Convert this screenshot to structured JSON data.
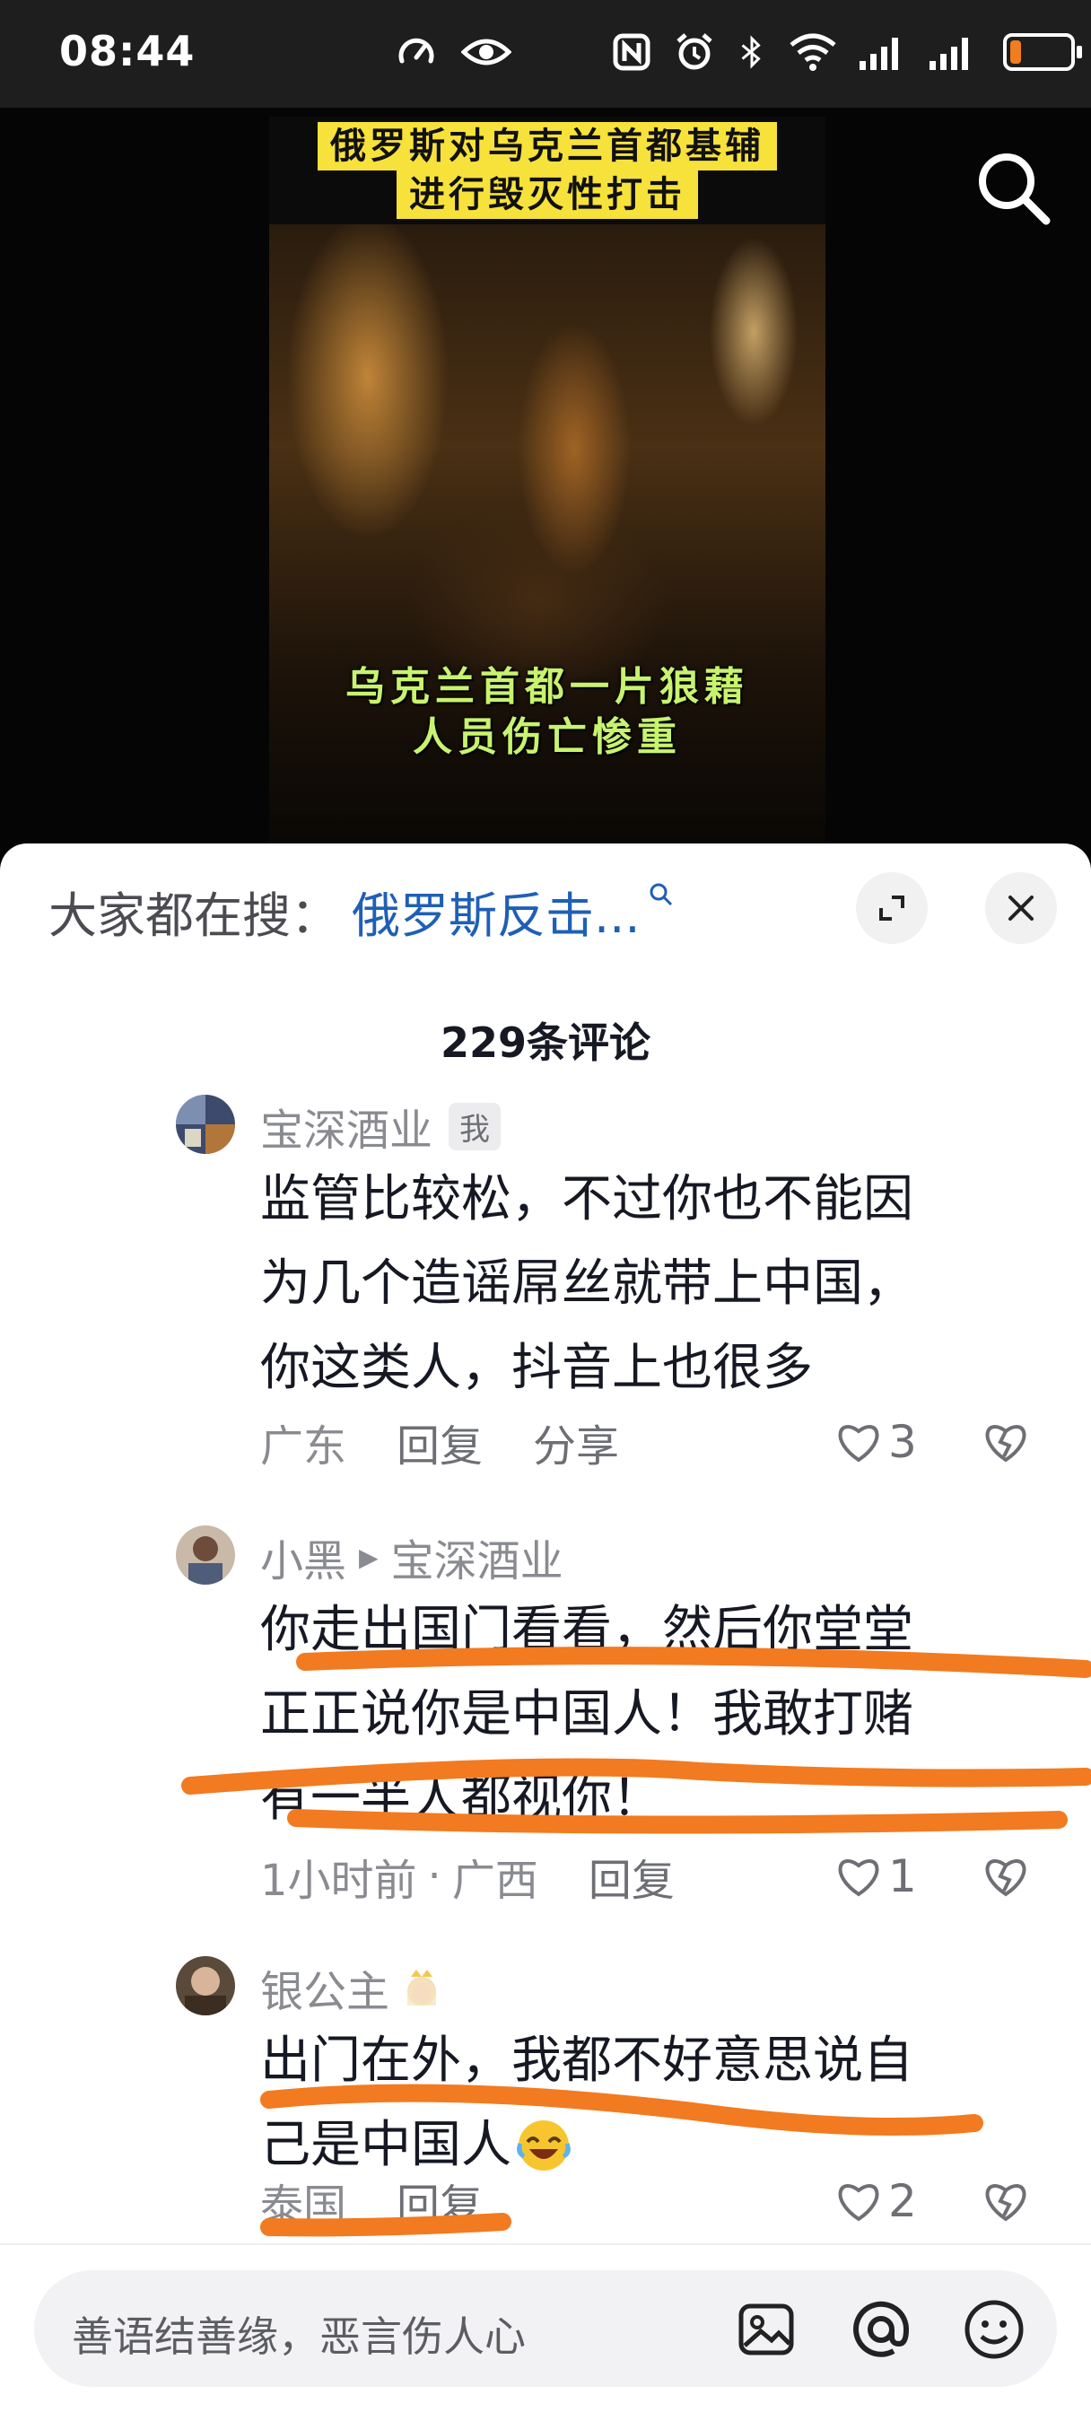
{
  "status_bar": {
    "time": "08:44",
    "icons": [
      "speedometer-icon",
      "eye-icon",
      "nfc-icon",
      "alarm-icon",
      "bluetooth-icon",
      "wifi-icon",
      "signal-icon",
      "signal-icon",
      "battery-icon"
    ],
    "battery_level": 0.18,
    "battery_color": "#f07d1f"
  },
  "video": {
    "caption_top_line1": "俄罗斯对乌克兰首都基辅",
    "caption_top_line2": "进行毁灭性打击",
    "caption_bottom_line1": "乌克兰首都一片狼藉",
    "caption_bottom_line2": "人员伤亡惨重",
    "search_icon": "search-icon"
  },
  "sheet": {
    "hot_search_prefix": "大家都在搜：",
    "hot_search_query": "俄罗斯反击...",
    "comment_count_label": "229条评论"
  },
  "comments": [
    {
      "user": "宝深酒业",
      "tag": "我",
      "lines": [
        "监管比较松，不过你也不能因",
        "为几个造谣屌丝就带上中国，",
        "你这类人，抖音上也很多"
      ],
      "location": "广东",
      "reply_label": "回复",
      "share_label": "分享",
      "likes": "3"
    },
    {
      "user": "小黑",
      "reply_to": "宝深酒业",
      "lines": [
        "你走出国门看看，然后你堂堂",
        "正正说你是中国人！我敢打赌",
        "有一半人都视你！"
      ],
      "time": "1小时前",
      "location": "广西",
      "reply_label": "回复",
      "likes": "1"
    },
    {
      "user": "银公主",
      "badge_icon": "princess-emoji-icon",
      "lines": [
        "出门在外，我都不好意思说自",
        "己是中国人"
      ],
      "emoji_icon": "laughing-crying-emoji-icon",
      "location": "泰国",
      "reply_label": "回复",
      "likes": "2"
    }
  ],
  "input_bar": {
    "placeholder": "善语结善缘，恶言伤人心",
    "icons": [
      "image-icon",
      "at-icon",
      "emoji-icon"
    ]
  },
  "colors": {
    "link_blue": "#1f5fb6",
    "caption_yellow": "#f7e23b",
    "caption_green": "#c8f36f",
    "scribble_orange": "#f27a20"
  }
}
